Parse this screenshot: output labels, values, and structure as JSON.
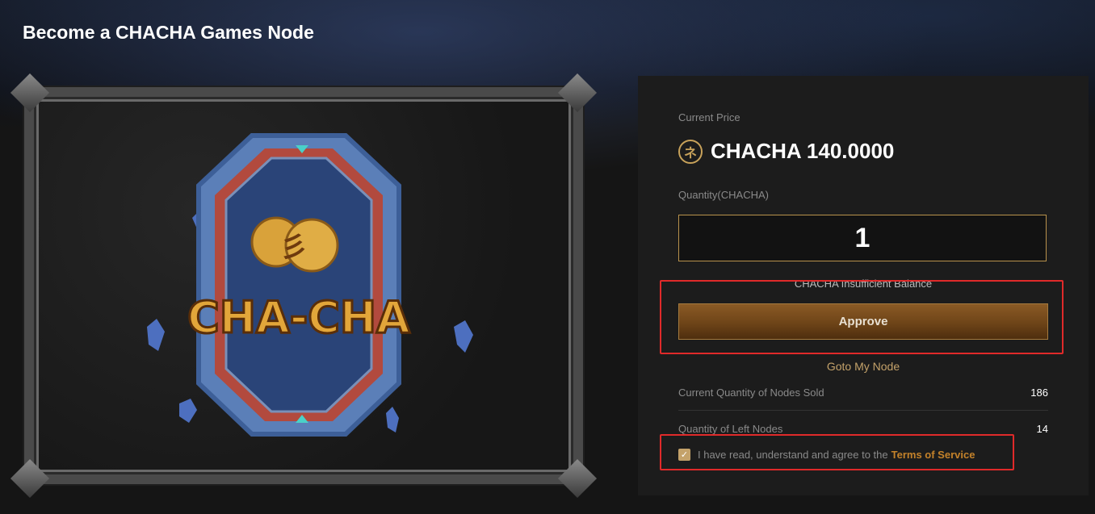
{
  "page": {
    "title": "Become a CHACHA Games Node"
  },
  "art": {
    "logo_text": "CHA-CHA",
    "coin_glyph": "彡"
  },
  "panel": {
    "price_label": "Current Price",
    "price_icon": "chacha-coin-icon",
    "price_value": "CHACHA 140.0000",
    "quantity_label": "Quantity(CHACHA)",
    "quantity_value": "1",
    "balance_warning": "CHACHA Insufficient Balance",
    "approve_label": "Approve",
    "goto_label": "Goto My Node",
    "stats": [
      {
        "label": "Current Quantity of Nodes Sold",
        "value": "186"
      },
      {
        "label": "Quantity of Left Nodes",
        "value": "14"
      }
    ],
    "agree_text": "I have read, understand and agree to the",
    "agree_checked": true,
    "tos_label": "Terms of Service"
  },
  "colors": {
    "accent": "#c4a26a",
    "button": "#6e4418",
    "highlight": "#e02a2a"
  }
}
